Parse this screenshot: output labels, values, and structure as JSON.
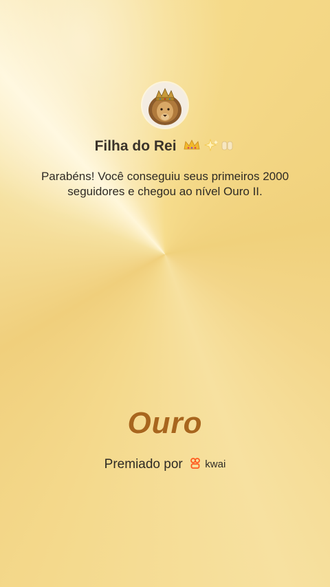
{
  "profile": {
    "avatar_icon": "lion-with-crown",
    "username": "Filha do Rei",
    "username_emojis": [
      "crown",
      "sparkles",
      "praying-hands"
    ]
  },
  "message": "Parabéns! Você conseguiu seus primeiros 2000 seguidores e chegou ao nível Ouro II.",
  "level": "Ouro",
  "awarded": {
    "label": "Premiado por",
    "brand_name": "kwai",
    "brand_color": "#ff5a1f"
  },
  "colors": {
    "background": "#f6dc8c",
    "level_text": "#a8661e",
    "text": "#2e2a24"
  }
}
